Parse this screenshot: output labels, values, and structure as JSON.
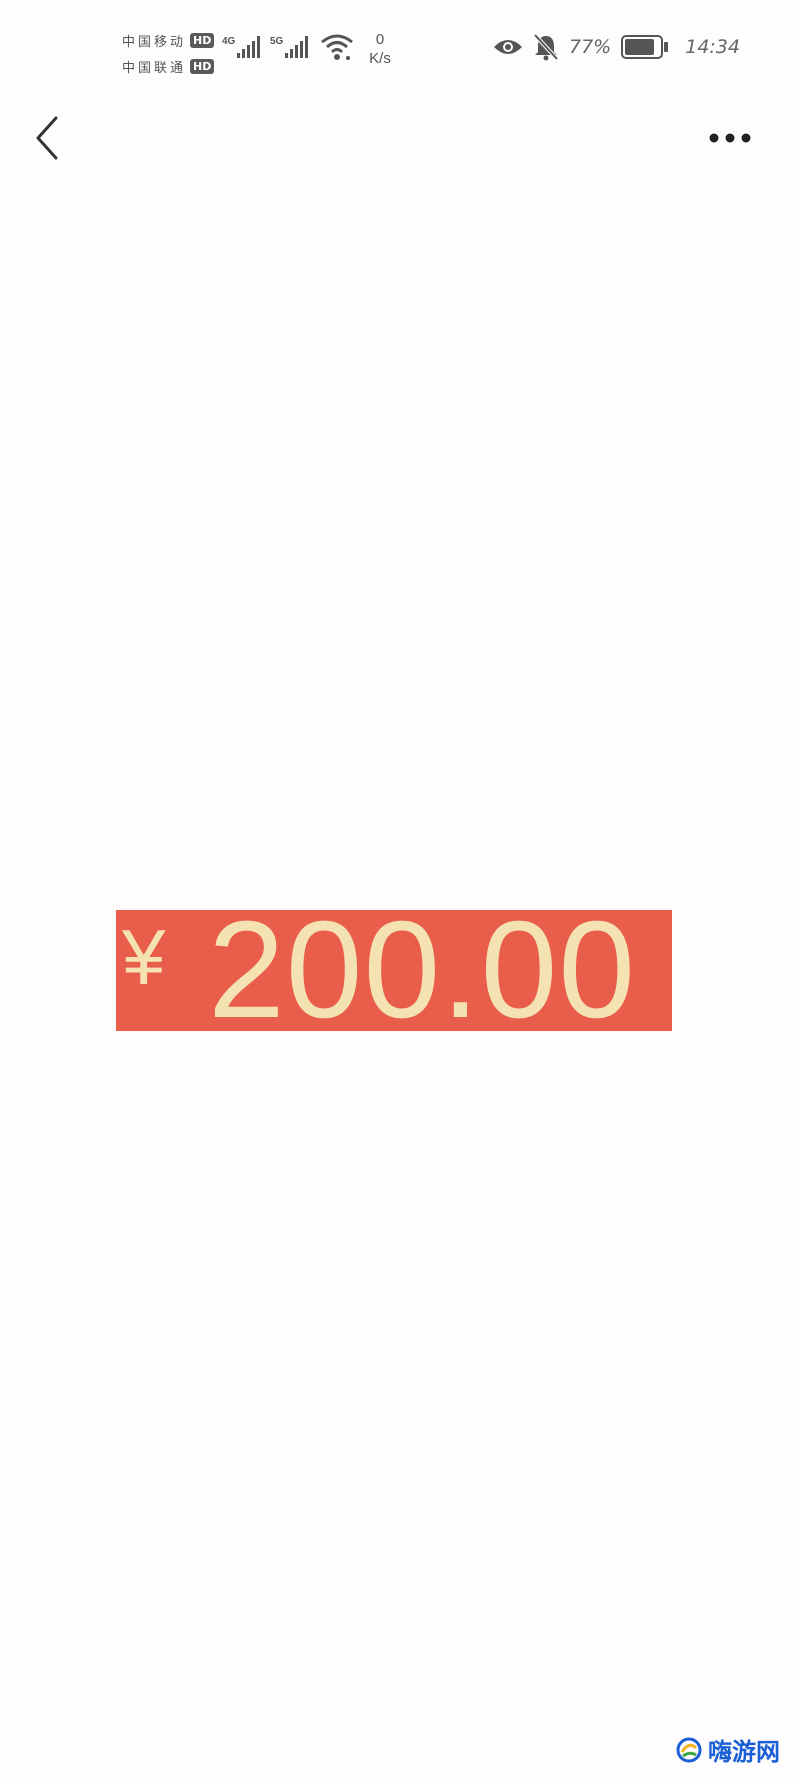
{
  "status_bar": {
    "carrier_1": "中国移动",
    "carrier_2": "中国联通",
    "hd_label": "HD",
    "network_1": "4G",
    "network_2": "5G",
    "net_speed_value": "0",
    "net_speed_unit": "K/s",
    "battery_percent": "77%",
    "time": "14:34",
    "icons": [
      "eye-icon",
      "bell-muted-icon",
      "battery-icon",
      "wifi-icon",
      "signal-icon"
    ]
  },
  "header": {
    "back_icon": "chevron-left-icon",
    "more_icon": "more-dots-icon"
  },
  "main": {
    "currency": "¥",
    "amount": "200.00",
    "banner_color": "#e95d4b",
    "text_color": "#f5e2b3"
  },
  "watermark": {
    "text": "嗨游网",
    "color": "#1a5fd6"
  }
}
